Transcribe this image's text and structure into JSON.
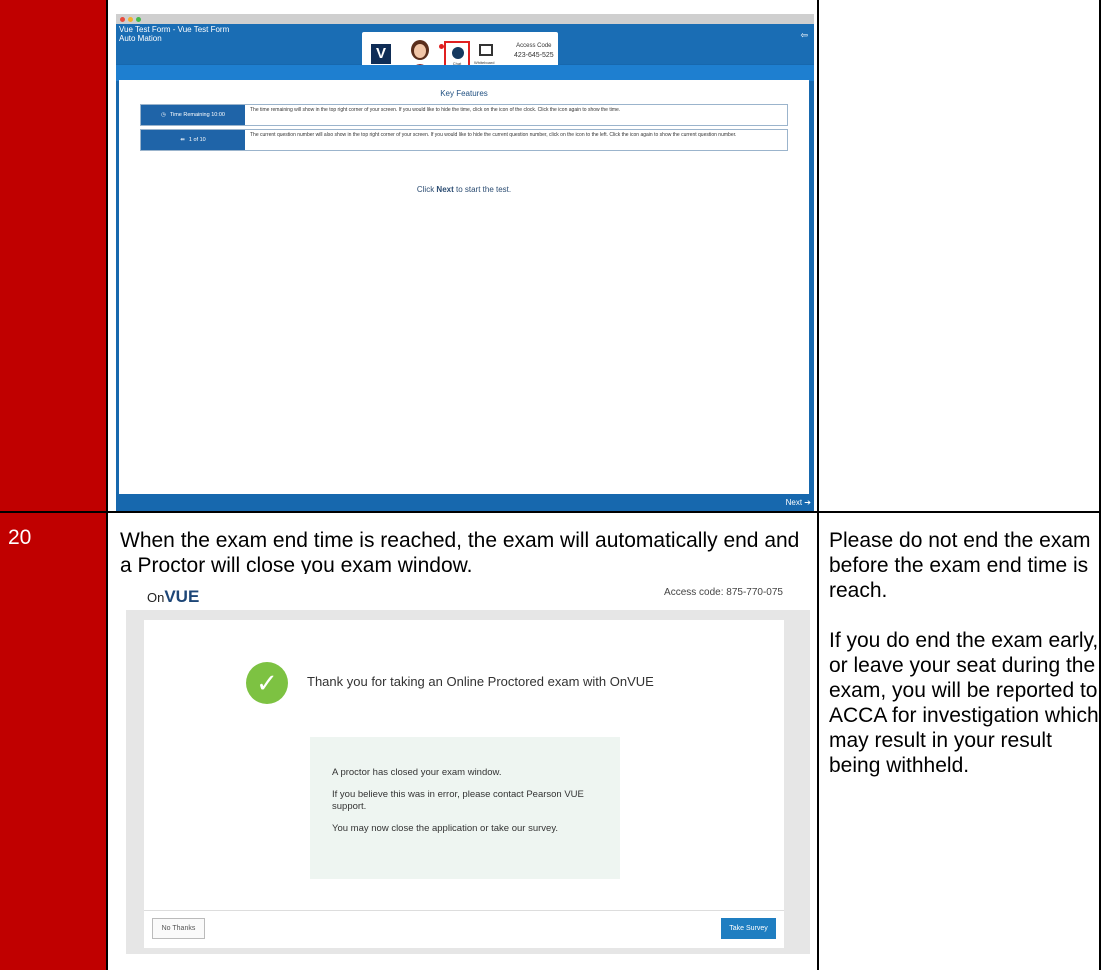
{
  "row1": {
    "shot": {
      "title_line1": "Vue Test Form - Vue Test Form",
      "title_line2": "Auto Mation",
      "chat_label": "Chat",
      "whiteboard_label": "Whiteboard",
      "access_label": "Access Code",
      "access_code": "423-645-525",
      "key_features_title": "Key Features",
      "features": [
        {
          "label": "Time Remaining 10:00",
          "text": "The time remaining will show in the top right corner of your screen. If you would like to hide the time, click on the icon of the clock. Click the icon again to show the time."
        },
        {
          "label": "1 of 10",
          "text": "The current question number will also show in the top right corner of your screen. If you would like to hide the current question number, click on the icon to the left. Click the icon again to show the current question number."
        }
      ],
      "click_prefix": "Click ",
      "click_bold": "Next",
      "click_suffix": " to start the test.",
      "next_button": "Next"
    }
  },
  "row2": {
    "number": "20",
    "instruction": "When the exam end time is reached, the exam will automatically end and a Proctor will close you exam window.",
    "note_p1": "Please do not end the exam before the exam end time is reach.",
    "note_p2": "If you do end the exam early, or leave your seat during the exam, you will be reported to ACCA for investigation which may result in your result being withheld.",
    "shot": {
      "logo_on": "On",
      "logo_vue": "VUE",
      "access_code": "Access code: 875-770-075",
      "thanks": "Thank you for taking an Online Proctored exam with OnVUE",
      "msg1": "A proctor has closed your exam window.",
      "msg2": "If you believe this was in error, please contact Pearson VUE support.",
      "msg3": "You may now close the application or take our survey.",
      "no_thanks": "No Thanks",
      "take_survey": "Take Survey"
    }
  }
}
